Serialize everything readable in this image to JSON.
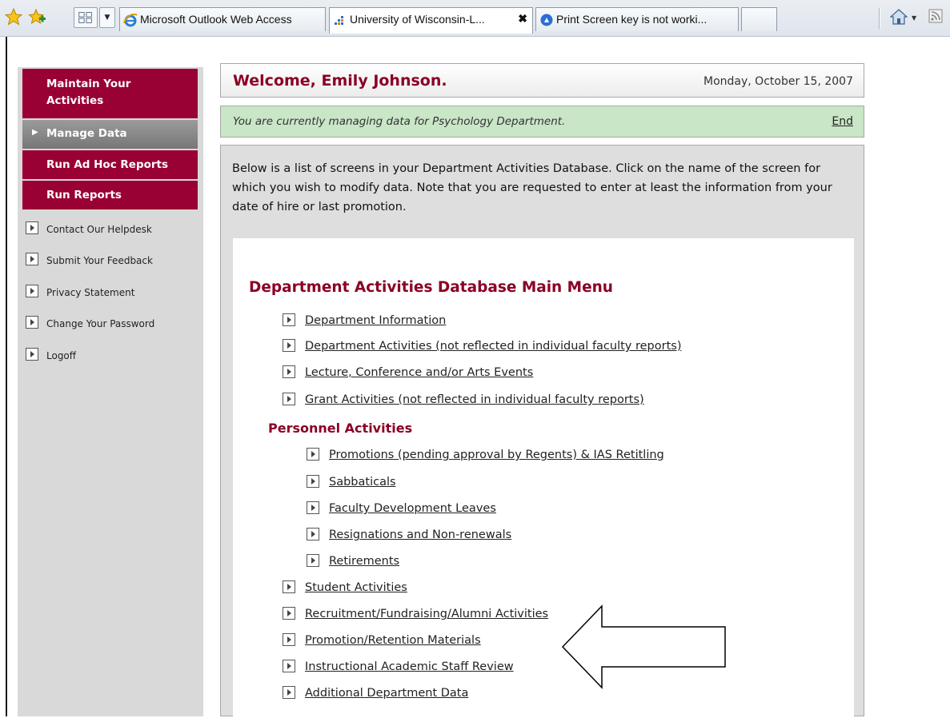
{
  "browser": {
    "tabs": [
      {
        "title": "Microsoft Outlook Web Access",
        "active": false
      },
      {
        "title": "University of Wisconsin-L...",
        "active": true
      },
      {
        "title": "Print Screen key is not worki...",
        "active": false
      },
      {
        "title": "",
        "active": false
      }
    ],
    "close_glyph": "✖",
    "tab_list_glyph": "▼",
    "home_drop_glyph": "▼",
    "icons": [
      "favorites-star-icon",
      "add-favorites-icon",
      "quick-tabs-icon",
      "tab-list-icon",
      "ie-logo-icon",
      "home-icon",
      "feeds-icon"
    ]
  },
  "sidebar": {
    "nav": [
      {
        "label": "Maintain Your Activities"
      },
      {
        "label": "Manage Data",
        "arrow": "▶"
      },
      {
        "label": "Run Ad Hoc Reports"
      },
      {
        "label": "Run Reports"
      }
    ],
    "links": [
      {
        "label": "Contact Our Helpdesk"
      },
      {
        "label": "Submit Your Feedback"
      },
      {
        "label": "Privacy Statement"
      },
      {
        "label": "Change Your Password"
      },
      {
        "label": "Logoff"
      }
    ]
  },
  "header": {
    "welcome": "Welcome, Emily Johnson.",
    "date": "Monday, October 15, 2007"
  },
  "managing": {
    "text": "You are currently managing data for Psychology Department.",
    "end_label": "End"
  },
  "intro": "Below is a list of screens in your Department Activities Database. Click on the name of the screen for which you wish to modify data. Note that you are requested to enter at least the information from your date of hire or last promotion.",
  "menu": {
    "title": "Department Activities Database Main Menu",
    "top_items": [
      "Department Information",
      "Department Activities (not reflected in individual faculty reports)",
      "Lecture, Conference and/or Arts Events",
      "Grant Activities (not reflected in individual faculty reports)"
    ],
    "personnel_heading": "Personnel Activities",
    "personnel_items": [
      "Promotions (pending approval by Regents) & IAS Retitling",
      "Sabbaticals",
      "Faculty Development Leaves",
      "Resignations and Non-renewals",
      "Retirements"
    ],
    "bottom_items": [
      "Student Activities",
      "Recruitment/Fundraising/Alumni Activities",
      "Promotion/Retention Materials",
      "Instructional Academic Staff Review",
      "Additional Department Data"
    ]
  },
  "colors": {
    "maroon": "#990033",
    "title_maroon": "#8b0024",
    "managing_green": "#c9e6c7",
    "sidebar_gray": "#d9d9d9",
    "content_gray": "#dedede"
  }
}
